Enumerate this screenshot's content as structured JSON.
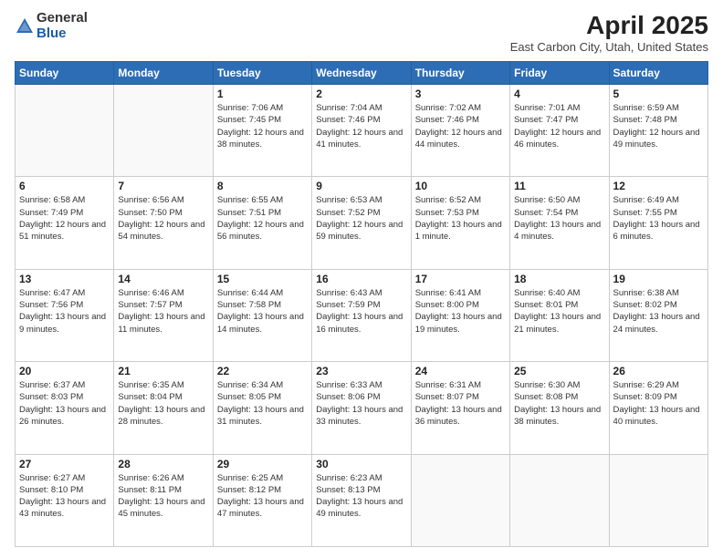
{
  "header": {
    "logo": {
      "general": "General",
      "blue": "Blue"
    },
    "title": "April 2025",
    "subtitle": "East Carbon City, Utah, United States"
  },
  "weekdays": [
    "Sunday",
    "Monday",
    "Tuesday",
    "Wednesday",
    "Thursday",
    "Friday",
    "Saturday"
  ],
  "weeks": [
    [
      {
        "day": "",
        "info": ""
      },
      {
        "day": "",
        "info": ""
      },
      {
        "day": "1",
        "info": "Sunrise: 7:06 AM\nSunset: 7:45 PM\nDaylight: 12 hours and 38 minutes."
      },
      {
        "day": "2",
        "info": "Sunrise: 7:04 AM\nSunset: 7:46 PM\nDaylight: 12 hours and 41 minutes."
      },
      {
        "day": "3",
        "info": "Sunrise: 7:02 AM\nSunset: 7:46 PM\nDaylight: 12 hours and 44 minutes."
      },
      {
        "day": "4",
        "info": "Sunrise: 7:01 AM\nSunset: 7:47 PM\nDaylight: 12 hours and 46 minutes."
      },
      {
        "day": "5",
        "info": "Sunrise: 6:59 AM\nSunset: 7:48 PM\nDaylight: 12 hours and 49 minutes."
      }
    ],
    [
      {
        "day": "6",
        "info": "Sunrise: 6:58 AM\nSunset: 7:49 PM\nDaylight: 12 hours and 51 minutes."
      },
      {
        "day": "7",
        "info": "Sunrise: 6:56 AM\nSunset: 7:50 PM\nDaylight: 12 hours and 54 minutes."
      },
      {
        "day": "8",
        "info": "Sunrise: 6:55 AM\nSunset: 7:51 PM\nDaylight: 12 hours and 56 minutes."
      },
      {
        "day": "9",
        "info": "Sunrise: 6:53 AM\nSunset: 7:52 PM\nDaylight: 12 hours and 59 minutes."
      },
      {
        "day": "10",
        "info": "Sunrise: 6:52 AM\nSunset: 7:53 PM\nDaylight: 13 hours and 1 minute."
      },
      {
        "day": "11",
        "info": "Sunrise: 6:50 AM\nSunset: 7:54 PM\nDaylight: 13 hours and 4 minutes."
      },
      {
        "day": "12",
        "info": "Sunrise: 6:49 AM\nSunset: 7:55 PM\nDaylight: 13 hours and 6 minutes."
      }
    ],
    [
      {
        "day": "13",
        "info": "Sunrise: 6:47 AM\nSunset: 7:56 PM\nDaylight: 13 hours and 9 minutes."
      },
      {
        "day": "14",
        "info": "Sunrise: 6:46 AM\nSunset: 7:57 PM\nDaylight: 13 hours and 11 minutes."
      },
      {
        "day": "15",
        "info": "Sunrise: 6:44 AM\nSunset: 7:58 PM\nDaylight: 13 hours and 14 minutes."
      },
      {
        "day": "16",
        "info": "Sunrise: 6:43 AM\nSunset: 7:59 PM\nDaylight: 13 hours and 16 minutes."
      },
      {
        "day": "17",
        "info": "Sunrise: 6:41 AM\nSunset: 8:00 PM\nDaylight: 13 hours and 19 minutes."
      },
      {
        "day": "18",
        "info": "Sunrise: 6:40 AM\nSunset: 8:01 PM\nDaylight: 13 hours and 21 minutes."
      },
      {
        "day": "19",
        "info": "Sunrise: 6:38 AM\nSunset: 8:02 PM\nDaylight: 13 hours and 24 minutes."
      }
    ],
    [
      {
        "day": "20",
        "info": "Sunrise: 6:37 AM\nSunset: 8:03 PM\nDaylight: 13 hours and 26 minutes."
      },
      {
        "day": "21",
        "info": "Sunrise: 6:35 AM\nSunset: 8:04 PM\nDaylight: 13 hours and 28 minutes."
      },
      {
        "day": "22",
        "info": "Sunrise: 6:34 AM\nSunset: 8:05 PM\nDaylight: 13 hours and 31 minutes."
      },
      {
        "day": "23",
        "info": "Sunrise: 6:33 AM\nSunset: 8:06 PM\nDaylight: 13 hours and 33 minutes."
      },
      {
        "day": "24",
        "info": "Sunrise: 6:31 AM\nSunset: 8:07 PM\nDaylight: 13 hours and 36 minutes."
      },
      {
        "day": "25",
        "info": "Sunrise: 6:30 AM\nSunset: 8:08 PM\nDaylight: 13 hours and 38 minutes."
      },
      {
        "day": "26",
        "info": "Sunrise: 6:29 AM\nSunset: 8:09 PM\nDaylight: 13 hours and 40 minutes."
      }
    ],
    [
      {
        "day": "27",
        "info": "Sunrise: 6:27 AM\nSunset: 8:10 PM\nDaylight: 13 hours and 43 minutes."
      },
      {
        "day": "28",
        "info": "Sunrise: 6:26 AM\nSunset: 8:11 PM\nDaylight: 13 hours and 45 minutes."
      },
      {
        "day": "29",
        "info": "Sunrise: 6:25 AM\nSunset: 8:12 PM\nDaylight: 13 hours and 47 minutes."
      },
      {
        "day": "30",
        "info": "Sunrise: 6:23 AM\nSunset: 8:13 PM\nDaylight: 13 hours and 49 minutes."
      },
      {
        "day": "",
        "info": ""
      },
      {
        "day": "",
        "info": ""
      },
      {
        "day": "",
        "info": ""
      }
    ]
  ]
}
